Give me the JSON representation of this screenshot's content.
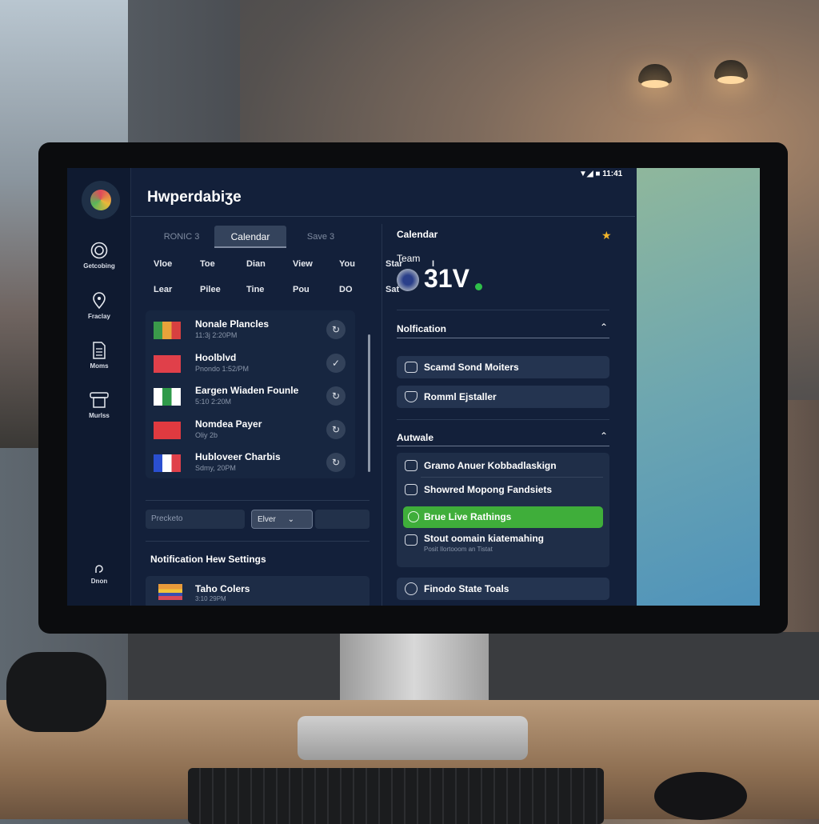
{
  "app": {
    "title": "Hwperdabiʒe",
    "status_time": "11:41"
  },
  "sidebar": {
    "items": [
      {
        "label": "Getcobing",
        "icon": "target-icon"
      },
      {
        "label": "Fraclay",
        "icon": "location-pin-icon"
      },
      {
        "label": "Moms",
        "icon": "document-icon"
      },
      {
        "label": "Murlss",
        "icon": "printer-icon"
      }
    ],
    "bottom": {
      "label": "Dnon",
      "icon": "refresh-icon"
    }
  },
  "tabs": [
    {
      "label": "RONIC 3"
    },
    {
      "label": "Calendar",
      "active": true
    },
    {
      "label": "Save 3"
    }
  ],
  "grid": {
    "row1": [
      "Vloe",
      "Toe",
      "Dian",
      "View",
      "You",
      "Star",
      "I"
    ],
    "row2": [
      "Lear",
      "Pilee",
      "Tine",
      "Pou",
      "DO",
      "Sat"
    ]
  },
  "list": [
    {
      "title": "Nonale Plancles",
      "sub": "11:3j 2:20PM",
      "action": "sync-icon",
      "flag": [
        "#3a9a4a",
        "#e8a33a",
        "#d84040"
      ]
    },
    {
      "title": "Hoolblvd",
      "sub": "Pnondo 1:52/PM",
      "action": "check-icon",
      "flag": [
        "#e0404a",
        "#e0404a",
        "#e0404a"
      ]
    },
    {
      "title": "Eargen Wiaden Founle",
      "sub": "5:10 2:20M",
      "action": "sync-icon",
      "flag": [
        "#fff",
        "#2f9a4a",
        "#fff"
      ]
    },
    {
      "title": "Nomdea Payer",
      "sub": "Oliy 2b",
      "action": "sync-icon",
      "flag": [
        "#e03a40",
        "#e03a40",
        "#e03a40"
      ]
    },
    {
      "title": "Hubloveer Charbis",
      "sub": "Sdmy, 20PM",
      "action": "sync-icon",
      "flag": [
        "#2a4fd0",
        "#ffffff",
        "#e0404a"
      ]
    }
  ],
  "filters": {
    "input_placeholder": "Precketo",
    "select_value": "Elver"
  },
  "settings": {
    "title": "Notification Hew Settings",
    "item": {
      "title": "Taho Colers",
      "sub": "3:10 29PM"
    }
  },
  "right": {
    "calendar_label": "Calendar",
    "team_label": "Team",
    "team_value": "31V",
    "status_color": "#2fbf4a",
    "notification": {
      "title": "Nolfication",
      "items": [
        "Scamd Sond Moiters",
        "Romml Ejstaller"
      ]
    },
    "autwale": {
      "title": "Autwale",
      "items": [
        "Gramo Anuer Kobbadlaskign",
        "Showred Mopong Fandsiets"
      ],
      "highlight": "Brue Live Rathings",
      "last": {
        "title": "Stout oomain kiatemahing",
        "sub": "Posit Ilortooom an Tistat"
      }
    },
    "footer_item": "Finodo State Toals"
  },
  "colors": {
    "accent_green": "#3fae3a",
    "background": "#13203a",
    "star": "#f2b42a"
  }
}
